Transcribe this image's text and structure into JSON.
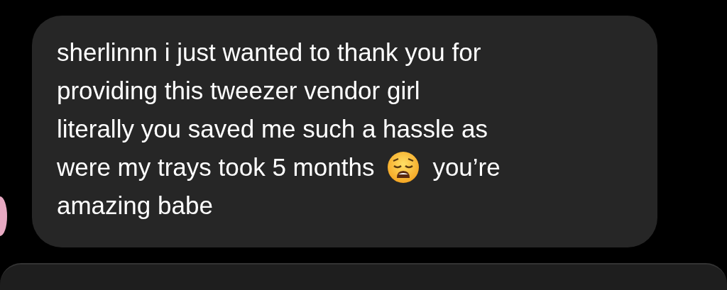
{
  "messages": [
    {
      "kind": "received",
      "avatar": true,
      "lines": [
        [
          {
            "kind": "text",
            "text": "sherlinnn i just wanted to thank you for"
          }
        ],
        [
          {
            "kind": "text",
            "text": "providing this tweezer vendor girl"
          }
        ],
        [
          {
            "kind": "text",
            "text": "literally you saved me such a hassle as"
          }
        ],
        [
          {
            "kind": "text",
            "text": "were my trays took 5 months"
          },
          {
            "kind": "emoji"
          },
          {
            "kind": "text",
            "text": "you’re"
          }
        ],
        [
          {
            "kind": "text",
            "text": "amazing babe"
          }
        ]
      ]
    },
    {
      "kind": "partial"
    }
  ]
}
